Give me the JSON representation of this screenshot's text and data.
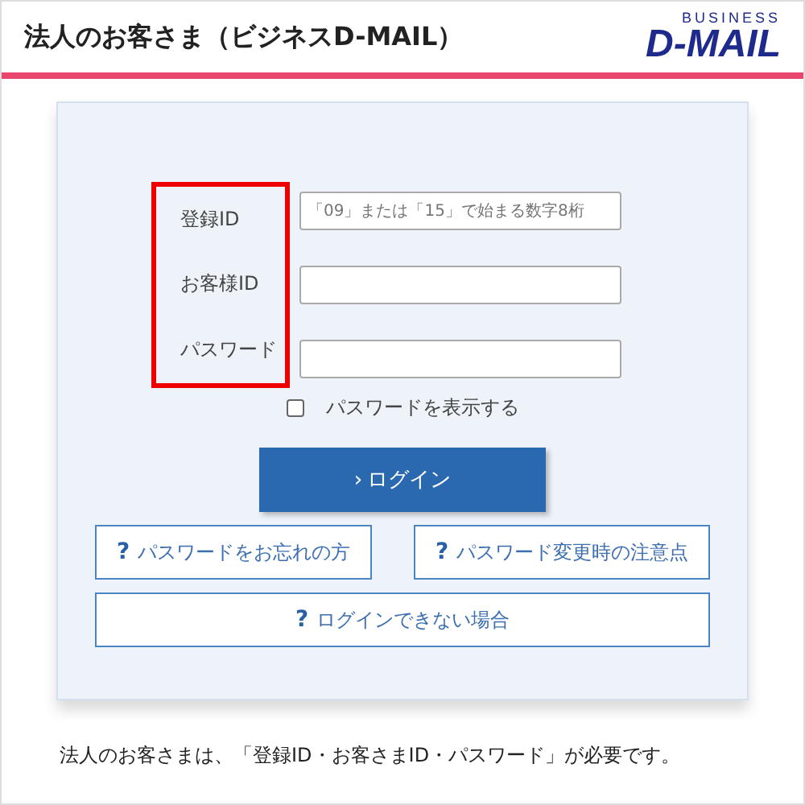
{
  "header": {
    "title": "法人のお客さま（ビジネスD-MAIL）",
    "logo_small": "BUSINESS",
    "logo_main": "D-MAIL"
  },
  "form": {
    "fields": [
      {
        "label": "登録ID",
        "placeholder": "「09」または「15」で始まる数字8桁"
      },
      {
        "label": "お客様ID"
      },
      {
        "label": "パスワード"
      }
    ],
    "show_password": {
      "label": "パスワードを表示する",
      "checked": false
    },
    "login_button": {
      "icon": "›",
      "label": "ログイン"
    },
    "help_links": [
      {
        "icon": "?",
        "label": "パスワードをお忘れの方"
      },
      {
        "icon": "?",
        "label": "パスワード変更時の注意点"
      },
      {
        "icon": "?",
        "label": "ログインできない場合"
      }
    ]
  },
  "note": "法人のお客さまは、「登録ID・お客さまID・パスワード」が必要です。"
}
